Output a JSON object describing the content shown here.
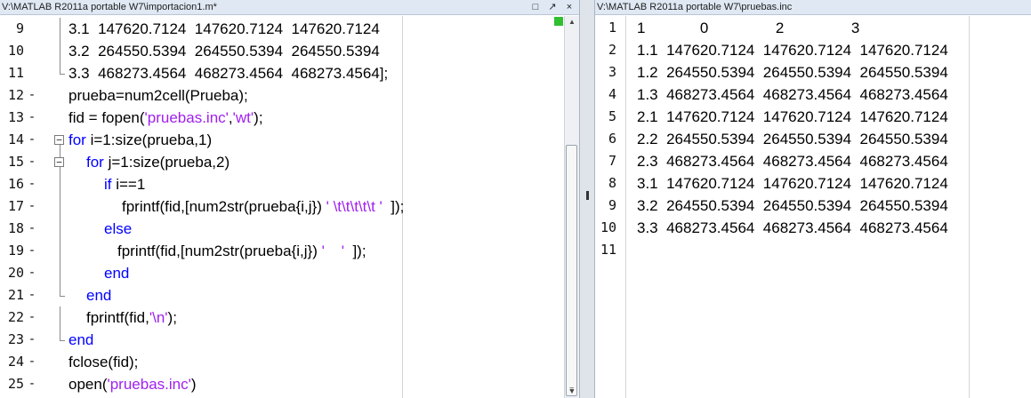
{
  "left_editor": {
    "title": "V:\\MATLAB R2011a  portable W7\\importacion1.m*",
    "lines": [
      {
        "n": "9",
        "mark": "",
        "indent": 77,
        "fold": "line",
        "segs": [
          {
            "t": "3.1  147620.7124  147620.7124  147620.7124",
            "c": ""
          }
        ]
      },
      {
        "n": "10",
        "mark": "",
        "indent": 77,
        "fold": "line",
        "segs": [
          {
            "t": "3.2  264550.5394  264550.5394  264550.5394",
            "c": ""
          }
        ]
      },
      {
        "n": "11",
        "mark": "",
        "indent": 77,
        "fold": "end",
        "segs": [
          {
            "t": "3.3  468273.4564  468273.4564  468273.4564];",
            "c": ""
          }
        ]
      },
      {
        "n": "12",
        "mark": "-",
        "indent": 77,
        "fold": "",
        "segs": [
          {
            "t": "prueba=num2cell(Prueba);",
            "c": ""
          }
        ]
      },
      {
        "n": "13",
        "mark": "-",
        "indent": 77,
        "fold": "",
        "segs": [
          {
            "t": "fid = fopen(",
            "c": ""
          },
          {
            "t": "'pruebas.inc'",
            "c": "str"
          },
          {
            "t": ",",
            "c": ""
          },
          {
            "t": "'wt'",
            "c": "str"
          },
          {
            "t": ");",
            "c": ""
          }
        ]
      },
      {
        "n": "14",
        "mark": "-",
        "indent": 77,
        "fold": "box",
        "segs": [
          {
            "t": "for",
            "c": "kw"
          },
          {
            "t": " i=1:size(prueba,1)",
            "c": ""
          }
        ]
      },
      {
        "n": "15",
        "mark": "-",
        "indent": 97,
        "fold": "box",
        "segs": [
          {
            "t": "for",
            "c": "kw"
          },
          {
            "t": " j=1:size(prueba,2)",
            "c": ""
          }
        ]
      },
      {
        "n": "16",
        "mark": "-",
        "indent": 117,
        "fold": "line",
        "segs": [
          {
            "t": "if",
            "c": "kw"
          },
          {
            "t": " i==1",
            "c": ""
          }
        ]
      },
      {
        "n": "17",
        "mark": "-",
        "indent": 137,
        "fold": "line",
        "segs": [
          {
            "t": "fprintf(fid,[num2str(prueba{i,j}) ",
            "c": ""
          },
          {
            "t": "' \\t\\t\\t\\t\\t '",
            "c": "str"
          },
          {
            "t": "  ]);",
            "c": ""
          }
        ]
      },
      {
        "n": "18",
        "mark": "-",
        "indent": 117,
        "fold": "line",
        "segs": [
          {
            "t": "else",
            "c": "kw"
          }
        ]
      },
      {
        "n": "19",
        "mark": "-",
        "indent": 132,
        "fold": "line",
        "segs": [
          {
            "t": "fprintf(fid,[num2str(prueba{i,j}) ",
            "c": ""
          },
          {
            "t": "'    '",
            "c": "str"
          },
          {
            "t": "  ]);",
            "c": ""
          }
        ]
      },
      {
        "n": "20",
        "mark": "-",
        "indent": 117,
        "fold": "line",
        "segs": [
          {
            "t": "end",
            "c": "kw"
          }
        ]
      },
      {
        "n": "21",
        "mark": "-",
        "indent": 97,
        "fold": "end",
        "segs": [
          {
            "t": "end",
            "c": "kw"
          }
        ]
      },
      {
        "n": "22",
        "mark": "-",
        "indent": 97,
        "fold": "line",
        "segs": [
          {
            "t": "fprintf(fid,",
            "c": ""
          },
          {
            "t": "'\\n'",
            "c": "str"
          },
          {
            "t": ");",
            "c": ""
          }
        ]
      },
      {
        "n": "23",
        "mark": "-",
        "indent": 77,
        "fold": "end",
        "segs": [
          {
            "t": "end",
            "c": "kw"
          }
        ]
      },
      {
        "n": "24",
        "mark": "-",
        "indent": 77,
        "fold": "",
        "segs": [
          {
            "t": "fclose(fid);",
            "c": ""
          }
        ]
      },
      {
        "n": "25",
        "mark": "-",
        "indent": 77,
        "fold": "",
        "segs": [
          {
            "t": "open(",
            "c": ""
          },
          {
            "t": "'pruebas.inc'",
            "c": "str"
          },
          {
            "t": ")",
            "c": ""
          }
        ]
      }
    ]
  },
  "right_editor": {
    "title": "V:\\MATLAB R2011a  portable W7\\pruebas.inc",
    "lines": [
      {
        "n": "1",
        "t": "1             0                2                3"
      },
      {
        "n": "2",
        "t": "1.1  147620.7124  147620.7124  147620.7124"
      },
      {
        "n": "3",
        "t": "1.2  264550.5394  264550.5394  264550.5394"
      },
      {
        "n": "4",
        "t": "1.3  468273.4564  468273.4564  468273.4564"
      },
      {
        "n": "5",
        "t": "2.1  147620.7124  147620.7124  147620.7124"
      },
      {
        "n": "6",
        "t": "2.2  264550.5394  264550.5394  264550.5394"
      },
      {
        "n": "7",
        "t": "2.3  468273.4564  468273.4564  468273.4564"
      },
      {
        "n": "8",
        "t": "3.1  147620.7124  147620.7124  147620.7124"
      },
      {
        "n": "9",
        "t": "3.2  264550.5394  264550.5394  264550.5394"
      },
      {
        "n": "10",
        "t": "3.3  468273.4564  468273.4564  468273.4564"
      },
      {
        "n": "11",
        "t": ""
      }
    ]
  },
  "window_buttons": {
    "restore": "□",
    "undock": "↗",
    "close": "×"
  },
  "icons": {
    "scroll_up": "scroll-up-arrow-icon",
    "scroll_down": "scroll-down-arrow-icon",
    "status": "green-status-icon"
  },
  "colors": {
    "keyword": "#0000ff",
    "string": "#a020f0",
    "titlebar": "#dfe8f3",
    "status": "#2fbf2f"
  }
}
